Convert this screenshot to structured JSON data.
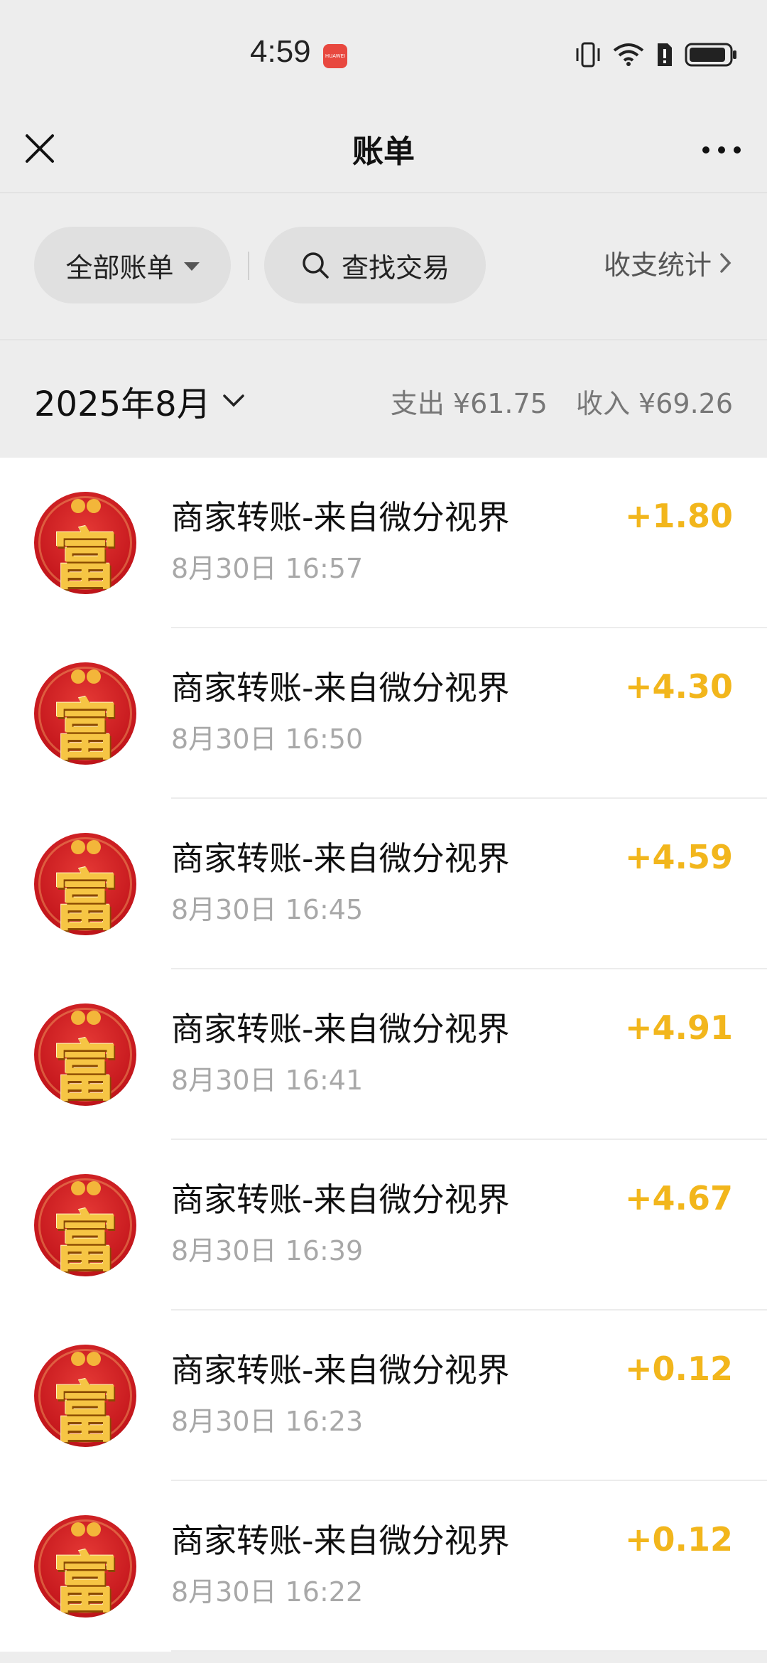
{
  "status": {
    "time": "4:59",
    "badge": "HUAWEI"
  },
  "nav": {
    "title": "账单"
  },
  "filters": {
    "all_bills": "全部账单",
    "search": "查找交易",
    "stats": "收支统计"
  },
  "month": {
    "label": "2025年8月",
    "expense": "支出 ¥61.75",
    "income": "收入 ¥69.26"
  },
  "transactions": [
    {
      "title": "商家转账-来自微分视界",
      "time": "8月30日 16:57",
      "amount": "+1.80",
      "avatar_glyph": "富"
    },
    {
      "title": "商家转账-来自微分视界",
      "time": "8月30日 16:50",
      "amount": "+4.30",
      "avatar_glyph": "富"
    },
    {
      "title": "商家转账-来自微分视界",
      "time": "8月30日 16:45",
      "amount": "+4.59",
      "avatar_glyph": "富"
    },
    {
      "title": "商家转账-来自微分视界",
      "time": "8月30日 16:41",
      "amount": "+4.91",
      "avatar_glyph": "富"
    },
    {
      "title": "商家转账-来自微分视界",
      "time": "8月30日 16:39",
      "amount": "+4.67",
      "avatar_glyph": "富"
    },
    {
      "title": "商家转账-来自微分视界",
      "time": "8月30日 16:23",
      "amount": "+0.12",
      "avatar_glyph": "富"
    },
    {
      "title": "商家转账-来自微分视界",
      "time": "8月30日 16:22",
      "amount": "+0.12",
      "avatar_glyph": "富"
    }
  ],
  "colors": {
    "background": "#ededed",
    "income_amount": "#f2b61c",
    "avatar_red": "#c4161c"
  }
}
